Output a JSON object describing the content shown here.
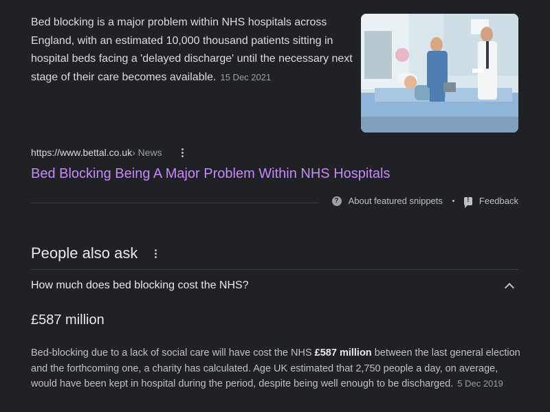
{
  "snippet": {
    "text": "Bed blocking is a major problem within NHS hospitals across England, with an estimated 10,000 thousand patients sitting in hospital beds facing a 'delayed discharge' until the necessary next stage of their care becomes available.",
    "date": "15 Dec 2021"
  },
  "source": {
    "url": "https://www.bettal.co.uk",
    "breadcrumb": " › News"
  },
  "result": {
    "title": "Bed Blocking Being A Major Problem Within NHS Hospitals"
  },
  "footer": {
    "about_label": "About featured snippets",
    "feedback_label": "Feedback"
  },
  "paa": {
    "title": "People also ask",
    "question": "How much does bed blocking cost the NHS?",
    "answer_heading": "£587 million",
    "answer_pre": "Bed-blocking due to a lack of social care will have cost the NHS ",
    "answer_bold": "£587 million",
    "answer_post": " between the last general election and the forthcoming one, a charity has calculated. Age UK estimated that 2,750 people a day, on average, would have been kept in hospital during the period, despite being well enough to be discharged.",
    "answer_date": "5 Dec 2019"
  },
  "icons": {
    "help": "?"
  },
  "colors": {
    "background": "#202124",
    "link_visited": "#c58af9",
    "text_primary": "#e8eaed",
    "text_secondary": "#bdc1c6",
    "meta": "#9aa0a6"
  }
}
